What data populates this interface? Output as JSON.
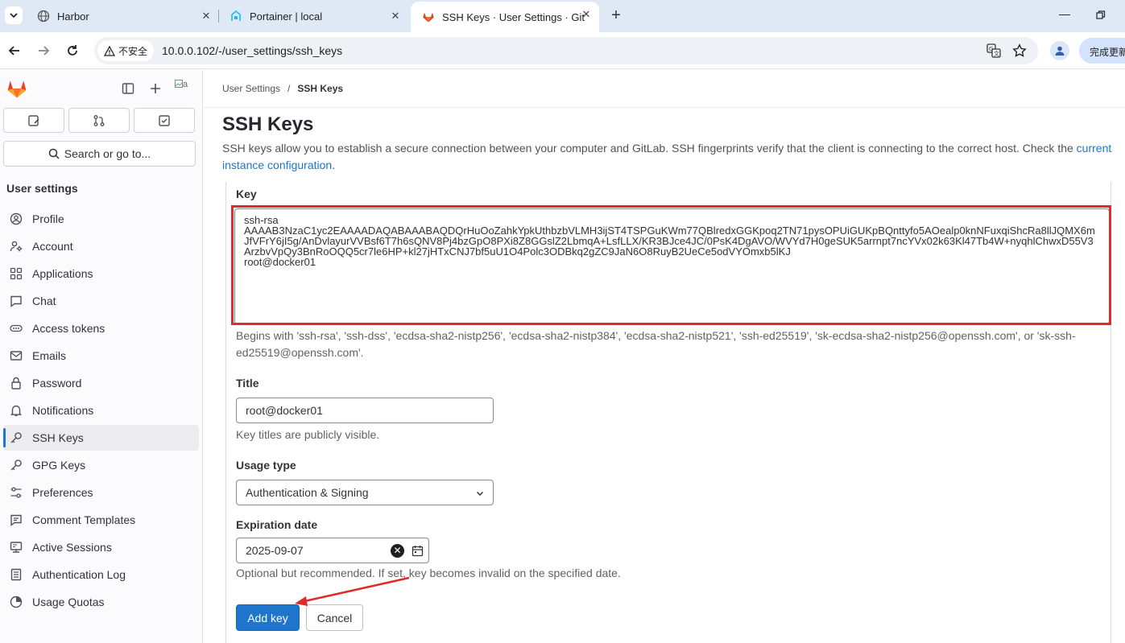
{
  "browser": {
    "tabs": [
      {
        "title": "Harbor",
        "active": false,
        "icon": "globe-icon"
      },
      {
        "title": "Portainer | local",
        "active": false,
        "icon": "portainer-icon"
      },
      {
        "title": "SSH Keys · User Settings · Git",
        "active": true,
        "icon": "gitlab-tanuki-icon"
      }
    ],
    "security_label": "不安全",
    "url": "10.0.0.102/-/user_settings/ssh_keys",
    "update_button": "完成更新"
  },
  "sidebar": {
    "search_label": "Search or go to...",
    "avatar_alt": "a",
    "heading": "User settings",
    "items": [
      {
        "label": "Profile",
        "icon": "profile-icon"
      },
      {
        "label": "Account",
        "icon": "account-icon"
      },
      {
        "label": "Applications",
        "icon": "applications-icon"
      },
      {
        "label": "Chat",
        "icon": "chat-icon"
      },
      {
        "label": "Access tokens",
        "icon": "token-icon"
      },
      {
        "label": "Emails",
        "icon": "mail-icon"
      },
      {
        "label": "Password",
        "icon": "lock-icon"
      },
      {
        "label": "Notifications",
        "icon": "bell-icon"
      },
      {
        "label": "SSH Keys",
        "icon": "key-icon",
        "active": true
      },
      {
        "label": "GPG Keys",
        "icon": "key-icon"
      },
      {
        "label": "Preferences",
        "icon": "preferences-icon"
      },
      {
        "label": "Comment Templates",
        "icon": "comment-icon"
      },
      {
        "label": "Active Sessions",
        "icon": "monitor-icon"
      },
      {
        "label": "Authentication Log",
        "icon": "log-icon"
      },
      {
        "label": "Usage Quotas",
        "icon": "quota-icon"
      }
    ]
  },
  "main": {
    "breadcrumb": [
      "User Settings",
      "SSH Keys"
    ],
    "title": "SSH Keys",
    "description": "SSH keys allow you to establish a secure connection between your computer and GitLab. SSH fingerprints verify that the client is connecting to the correct host. Check the ",
    "description_link": "current instance configuration",
    "description_end": ".",
    "key_label": "Key",
    "key_value": "ssh-rsa\nAAAAB3NzaC1yc2EAAAADAQABAAABAQDQrHuOoZahkYpkUthbzbVLMH3ijST4TSPGuKWm77QBlredxGGKpoq2TN71pysOPUiGUKpBQnttyfo5AOealp0knNFuxqiShcRa8llJQMX6mJfVFrY6jI5g/AnDvlayurVVBsf6T7h6sQNV8Pj4bzGpO8PXi8Z8GGslZ2LbmqA+LsfLLX/KR3BJce4JC/0PsK4DgAVO/WVYd7H0geSUK5arrnpt7ncYVx02k63Kl47Tb4W+nyqhlChwxD55V3ArzbvVpQy3BnRoOQQ5cr7le6HP+kl27jHTxCNJ7bf5uU1O4Polc3ODBkq2gZC9JaN6O8RuyB2UeCe5odVYOmxb5lKJ\nroot@docker01",
    "key_help": "Begins with 'ssh-rsa', 'ssh-dss', 'ecdsa-sha2-nistp256', 'ecdsa-sha2-nistp384', 'ecdsa-sha2-nistp521', 'ssh-ed25519', 'sk-ecdsa-sha2-nistp256@openssh.com', or 'sk-ssh-ed25519@openssh.com'.",
    "title_label": "Title",
    "title_value": "root@docker01",
    "title_help": "Key titles are publicly visible.",
    "usage_label": "Usage type",
    "usage_value": "Authentication & Signing",
    "expiration_label": "Expiration date",
    "expiration_value": "2025-09-07",
    "expiration_help": "Optional but recommended. If set, key becomes invalid on the specified date.",
    "add_button": "Add key",
    "cancel_button": "Cancel"
  },
  "colors": {
    "primary": "#1f75cb",
    "annotation": "#e32a2a",
    "tab_strip": "#dfe8f5"
  }
}
